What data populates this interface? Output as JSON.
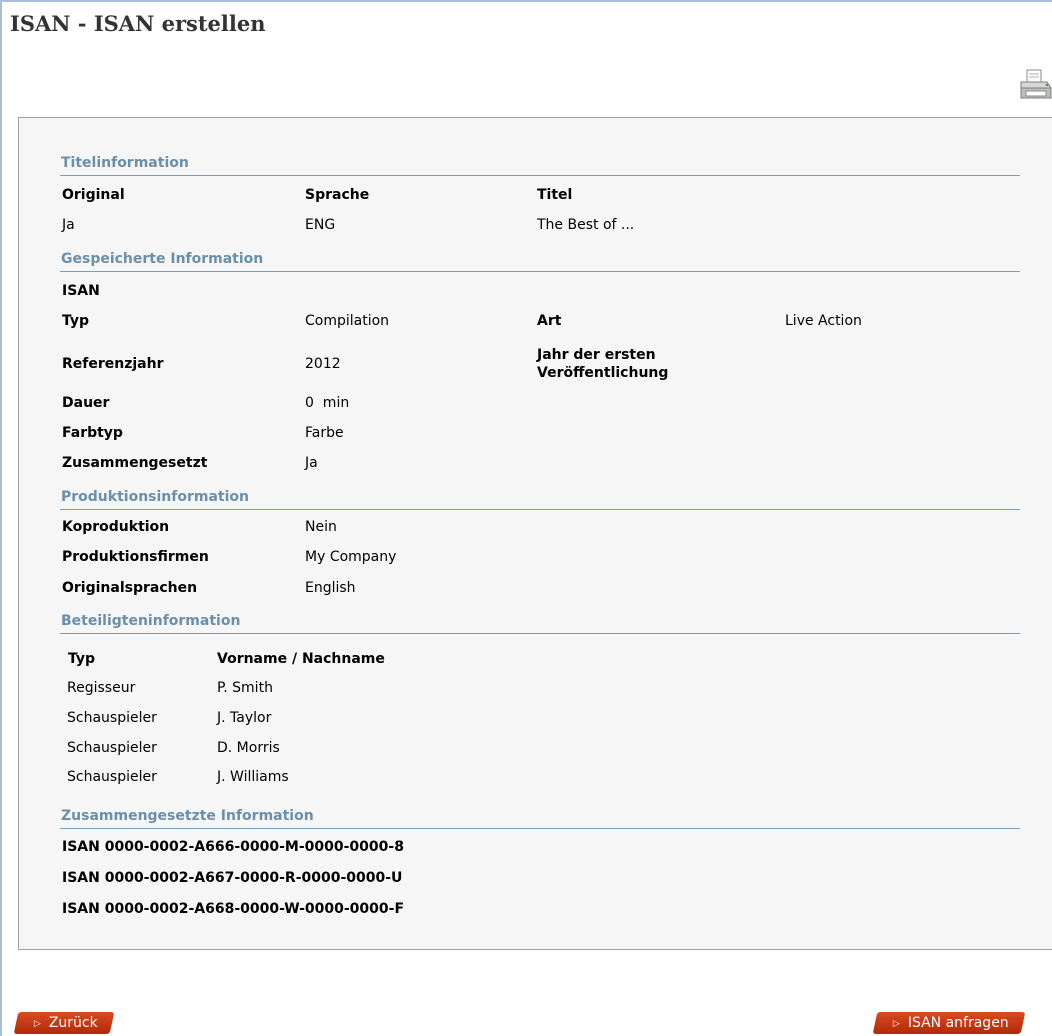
{
  "page": {
    "title": "ISAN - ISAN erstellen"
  },
  "titelinfo": {
    "heading": "Titelinformation",
    "col_original": "Original",
    "col_sprache": "Sprache",
    "col_titel": "Titel",
    "original": "Ja",
    "sprache": "ENG",
    "titel": "The Best of ..."
  },
  "gespeichert": {
    "heading": "Gespeicherte Information",
    "isan_label": "ISAN",
    "typ_label": "Typ",
    "typ_value": "Compilation",
    "art_label": "Art",
    "art_value": "Live Action",
    "referenzjahr_label": "Referenzjahr",
    "referenzjahr_value": "2012",
    "erstveroeffentlichung_label": "Jahr der ersten Veröffentlichung",
    "dauer_label": "Dauer",
    "dauer_value": "0  min",
    "farbtyp_label": "Farbtyp",
    "farbtyp_value": "Farbe",
    "zusammengesetzt_label": "Zusammengesetzt",
    "zusammengesetzt_value": "Ja"
  },
  "produktion": {
    "heading": "Produktionsinformation",
    "koproduktion_label": "Koproduktion",
    "koproduktion_value": "Nein",
    "firmen_label": "Produktionsfirmen",
    "firmen_value": "My Company",
    "sprachen_label": "Originalsprachen",
    "sprachen_value": "English"
  },
  "beteiligte": {
    "heading": "Beteiligteninformation",
    "col_typ": "Typ",
    "col_name": "Vorname / Nachname",
    "rows": [
      {
        "typ": "Regisseur",
        "name": "P. Smith"
      },
      {
        "typ": "Schauspieler",
        "name": "J. Taylor"
      },
      {
        "typ": "Schauspieler",
        "name": "D. Morris"
      },
      {
        "typ": "Schauspieler",
        "name": "J. Williams"
      }
    ]
  },
  "zusammengesetzte": {
    "heading": "Zusammengesetzte Information",
    "isans": [
      "ISAN 0000-0002-A666-0000-M-0000-0000-8",
      "ISAN 0000-0002-A667-0000-R-0000-0000-U",
      "ISAN 0000-0002-A668-0000-W-0000-0000-F"
    ]
  },
  "buttons": {
    "back": "Zurück",
    "request": "ISAN anfragen"
  },
  "colors": {
    "section_heading": "#6a8fab",
    "button": "#c8391a",
    "panel_bg": "#f6f6f6"
  },
  "icons": {
    "print": "printer-icon",
    "button_arrow": "play-arrow-icon"
  }
}
